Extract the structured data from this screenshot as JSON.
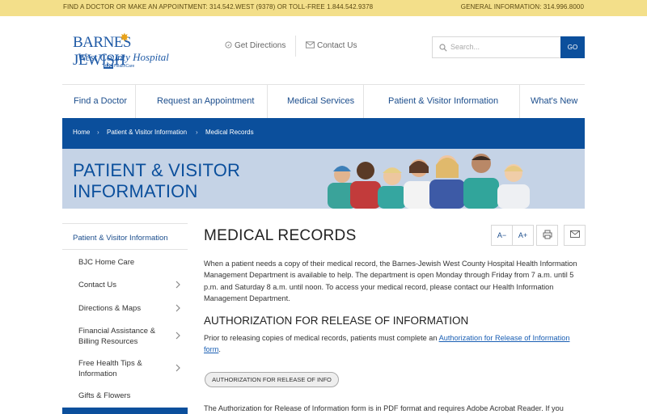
{
  "topbar": {
    "left_text": "FIND A DOCTOR OR MAKE AN APPOINTMENT: 314.542.WEST (9378) OR TOLL-FREE 1.844.542.9378",
    "right_text": "GENERAL INFORMATION: 314.996.8000",
    "bg_color": "#f3df8a"
  },
  "logo": {
    "line1": "BARNES JEWISH",
    "line2": "West County Hospital",
    "badge": "BJC",
    "badge_text": "HealthCare"
  },
  "utility": {
    "directions": "Get Directions",
    "contact": "Contact Us"
  },
  "search": {
    "placeholder": "Search...",
    "go_label": "GO"
  },
  "nav": {
    "items": [
      {
        "label": "Find a Doctor"
      },
      {
        "label": "Request an Appointment"
      },
      {
        "label": "Medical Services"
      },
      {
        "label": "Patient & Visitor Information"
      },
      {
        "label": "What's New"
      }
    ]
  },
  "breadcrumb": {
    "items": [
      "Home",
      "Patient & Visitor Information",
      "Medical Records"
    ]
  },
  "hero": {
    "title_line1": "PATIENT & VISITOR",
    "title_line2": "INFORMATION"
  },
  "sidebar": {
    "active_label": "Patient & Visitor Information",
    "items": [
      {
        "label": "BJC Home Care"
      },
      {
        "label": "Contact Us"
      },
      {
        "label": "Directions & Maps"
      },
      {
        "label": "Financial Assistance & Billing Resources"
      },
      {
        "label": "Free Health Tips & Information"
      },
      {
        "label": "Gifts & Flowers"
      }
    ]
  },
  "content": {
    "title": "MEDICAL RECORDS",
    "tools": {
      "decrease_font": "A−",
      "increase_font": "A+"
    },
    "intro": "When a patient needs a copy of their medical record, the Barnes-Jewish West County Hospital Health Information Management Department is available to help. The department is open Monday through Friday from 7 a.m. until 5 p.m. and Saturday 8 a.m. until noon. To access your medical record, please contact our Health Information Management Department.",
    "auth_heading": "AUTHORIZATION FOR RELEASE OF INFORMATION",
    "auth_text_prefix": "Prior to releasing copies of medical records, patients must complete an ",
    "auth_link": "Authorization for Release of Information form",
    "auth_text_suffix": ".",
    "auth_button": "AUTHORIZATION FOR RELEASE OF INFO",
    "pdf_note": "The Authorization for Release of Information form is in PDF format and requires Adobe Acrobat Reader. If you"
  },
  "colors": {
    "brand_blue": "#0b4f9c",
    "link_blue": "#1a5fb4",
    "hero_bg": "#c5d3e6"
  }
}
